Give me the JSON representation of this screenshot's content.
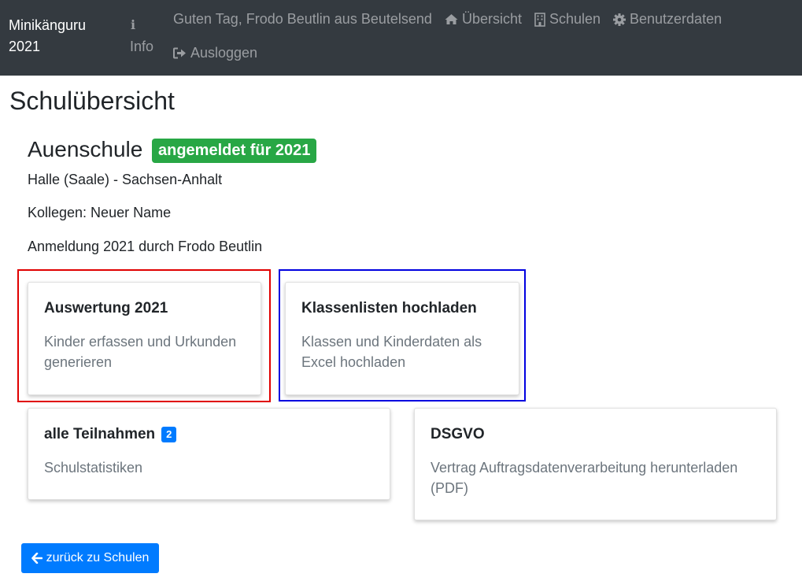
{
  "navbar": {
    "brand_line1": "Minikänguru",
    "brand_line2": "2021",
    "info_label": "Info",
    "info_icon": "info-icon",
    "greeting": "Guten Tag, Frodo Beutlin aus Beutelsend",
    "links": [
      {
        "label": "Übersicht",
        "icon": "home-icon"
      },
      {
        "label": "Schulen",
        "icon": "building-icon"
      },
      {
        "label": "Benutzerdaten",
        "icon": "gear-icon"
      },
      {
        "label": "Ausloggen",
        "icon": "sign-out-icon"
      }
    ]
  },
  "page": {
    "title": "Schulübersicht"
  },
  "school": {
    "name": "Auenschule",
    "status_badge": "angemeldet für 2021",
    "location": "Halle (Saale) - Sachsen-Anhalt",
    "colleagues": "Kollegen: Neuer Name",
    "registration": "Anmeldung 2021 durch Frodo Beutlin"
  },
  "cards": [
    {
      "title": "Auswertung 2021",
      "text": "Kinder erfassen und Urkunden generieren"
    },
    {
      "title": "Klassenlisten hochladen",
      "text": "Klassen und Kinderdaten als Excel hochladen"
    },
    {
      "title": "alle Teilnahmen",
      "badge": "2",
      "text": "Schulstatistiken"
    },
    {
      "title": "DSGVO",
      "text": "Vertrag Auftragsdatenverarbeitung herunterladen (PDF)"
    }
  ],
  "back_button": {
    "label": "zurück zu Schulen",
    "icon": "arrow-left-icon"
  },
  "colors": {
    "navbar": "#343a40",
    "success_badge": "#28a745",
    "primary": "#007bff",
    "highlight_red": "#e00000",
    "highlight_blue": "#0000e0"
  }
}
